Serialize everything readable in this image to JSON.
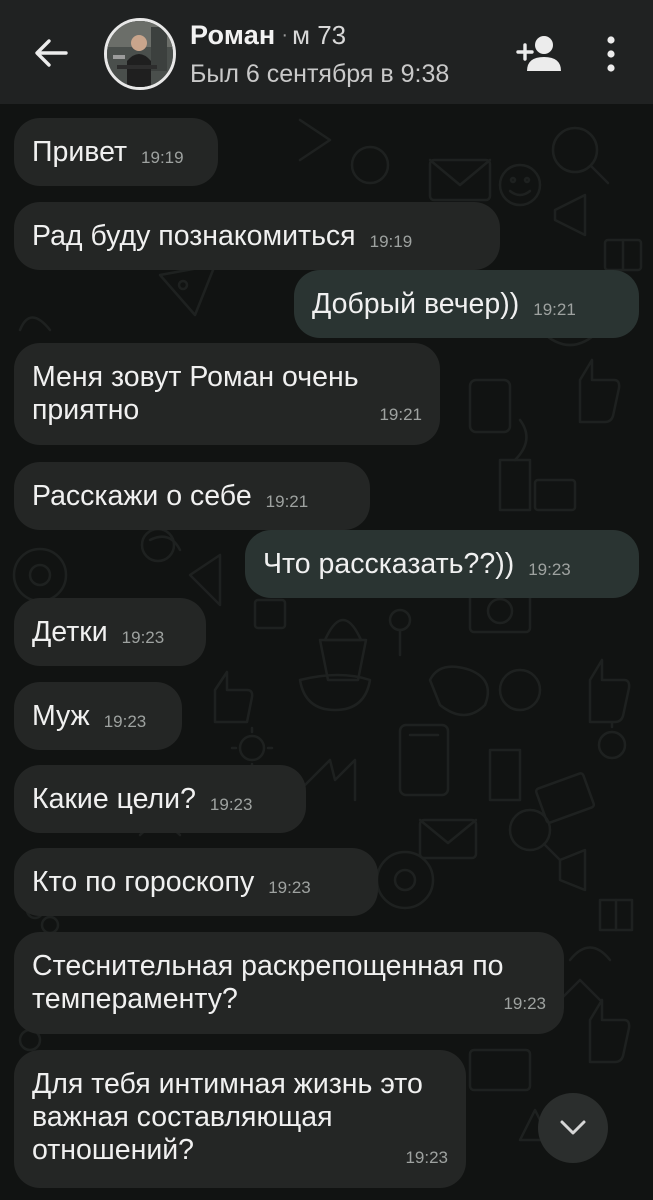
{
  "header": {
    "contact_name": "Роман",
    "separator": "·",
    "contact_meta": "м 73",
    "last_seen": "Был 6 сентября в 9:38"
  },
  "messages": [
    {
      "text": "Привет",
      "time": "19:19",
      "direction": "in"
    },
    {
      "text": "Рад буду познакомиться",
      "time": "19:19",
      "direction": "in"
    },
    {
      "text": "Добрый вечер))",
      "time": "19:21",
      "direction": "out"
    },
    {
      "text": "Меня зовут Роман очень приятно",
      "time": "19:21",
      "direction": "in"
    },
    {
      "text": "Расскажи о себе",
      "time": "19:21",
      "direction": "in"
    },
    {
      "text": "Что рассказать??))",
      "time": "19:23",
      "direction": "out"
    },
    {
      "text": "Детки",
      "time": "19:23",
      "direction": "in"
    },
    {
      "text": "Муж",
      "time": "19:23",
      "direction": "in"
    },
    {
      "text": "Какие цели?",
      "time": "19:23",
      "direction": "in"
    },
    {
      "text": "Кто по гороскопу",
      "time": "19:23",
      "direction": "in"
    },
    {
      "text": "Стеснительная раскрепощенная по темпераменту?",
      "time": "19:23",
      "direction": "in"
    },
    {
      "text": "Для тебя интимная жизнь это важная составляющая отношений?",
      "time": "19:23",
      "direction": "in"
    }
  ],
  "icons": {
    "back": "arrow-left-icon",
    "add_friend": "add-person-icon",
    "menu": "more-vertical-icon",
    "scroll_down": "chevron-down-icon"
  },
  "colors": {
    "header_bg": "#202222",
    "incoming_bubble": "#242625",
    "outgoing_bubble": "#2a3432",
    "chat_bg": "#111312"
  }
}
